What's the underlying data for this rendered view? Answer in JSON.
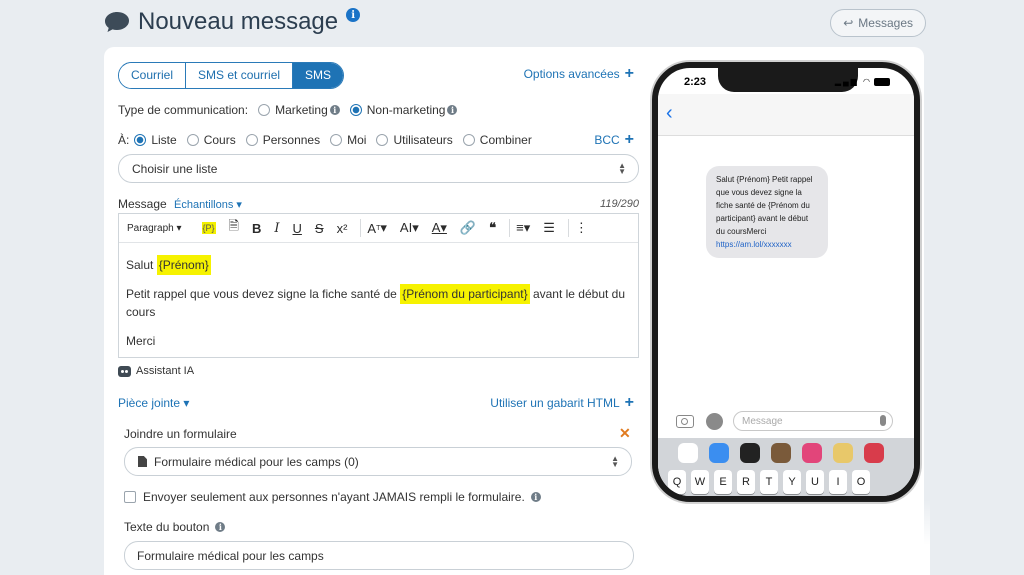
{
  "header": {
    "title": "Nouveau message",
    "info_icon": "i",
    "messages_button": "Messages"
  },
  "tabs": [
    {
      "label": "Courriel",
      "active": false
    },
    {
      "label": "SMS et courriel",
      "active": false
    },
    {
      "label": "SMS",
      "active": true
    }
  ],
  "advanced_options": "Options avancées",
  "communication": {
    "label": "Type de communication:",
    "options": [
      {
        "label": "Marketing",
        "selected": false
      },
      {
        "label": "Non-marketing",
        "selected": true
      }
    ]
  },
  "recipients": {
    "label": "À:",
    "options": [
      {
        "label": "Liste",
        "selected": true
      },
      {
        "label": "Cours",
        "selected": false
      },
      {
        "label": "Personnes",
        "selected": false
      },
      {
        "label": "Moi",
        "selected": false
      },
      {
        "label": "Utilisateurs",
        "selected": false
      },
      {
        "label": "Combiner",
        "selected": false
      }
    ],
    "bcc": "BCC"
  },
  "list_select": {
    "value": "Choisir une liste"
  },
  "message": {
    "label": "Message",
    "samples": "Échantillons",
    "counter": "119/290"
  },
  "toolbar": {
    "paragraph": "Paragraph",
    "placeholder_tag": "{P}"
  },
  "editor": {
    "line1_prefix": "Salut ",
    "line1_tag": "{Prénom}",
    "line2_prefix": "Petit rappel que vous devez signe la fiche santé de ",
    "line2_tag": "{Prénom du participant}",
    "line2_suffix": " avant le début du cours",
    "line3": "Merci"
  },
  "assistant": "Assistant IA",
  "attachment": {
    "label": "Pièce jointe",
    "html_template": "Utiliser un gabarit HTML",
    "join_form_label": "Joindre un formulaire",
    "form_select": "Formulaire médical pour les camps (0)",
    "only_never_filled": "Envoyer seulement aux personnes n'ayant JAMAIS rempli le formulaire.",
    "button_text_label": "Texte du bouton",
    "button_text_value": "Formulaire médical pour les camps"
  },
  "phone": {
    "time": "2:23",
    "bubble_text": "Salut {Prénom} Petit rappel que vous devez signe la fiche santé de {Prénom du participant} avant le début du coursMerci",
    "bubble_link": "https://am.lol/xxxxxxx",
    "compose_placeholder": "Message",
    "keys": [
      "Q",
      "W",
      "E",
      "R",
      "T",
      "Y",
      "U",
      "I",
      "O"
    ]
  },
  "colors": {
    "accent": "#1e73b5",
    "highlight": "#f6f200",
    "remove": "#e07a1f"
  }
}
